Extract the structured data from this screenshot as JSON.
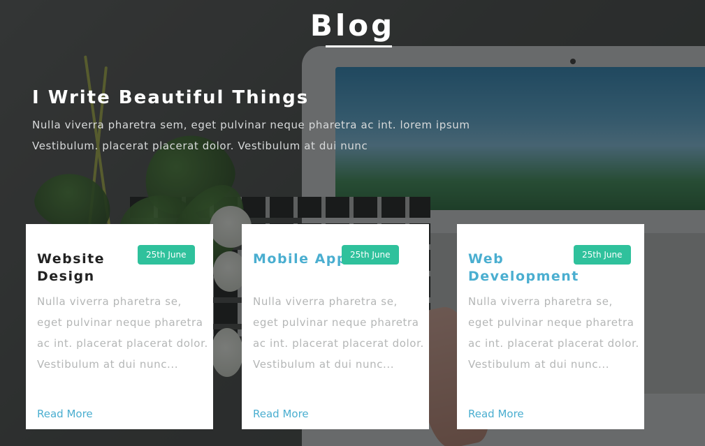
{
  "page": {
    "title": "Blog"
  },
  "hero": {
    "heading": "I Write Beautiful Things",
    "text": "Nulla viverra pharetra sem, eget pulvinar neque pharetra ac int. lorem ipsum Vestibulum. placerat placerat dolor. Vestibulum at dui nunc"
  },
  "cards": [
    {
      "title": "Website Design",
      "date": "25th June",
      "excerpt": "Nulla viverra pharetra se, eget pulvinar neque pharetra ac int. placerat placerat dolor. Vestibulum at dui nunc...",
      "link_label": "Read More",
      "title_color": "#222222"
    },
    {
      "title": "Mobile Apps",
      "date": "25th June",
      "excerpt": "Nulla viverra pharetra se, eget pulvinar neque pharetra ac int. placerat placerat dolor. Vestibulum at dui nunc...",
      "link_label": "Read More",
      "title_color": "#4aaed0"
    },
    {
      "title": "Web Development",
      "date": "25th June",
      "excerpt": "Nulla viverra pharetra se, eget pulvinar neque pharetra ac int. placerat placerat dolor. Vestibulum at dui nunc...",
      "link_label": "Read More",
      "title_color": "#4aaed0"
    }
  ],
  "colors": {
    "accent": "#2fc19c",
    "link": "#4aaed0",
    "overlay": "#141616"
  }
}
